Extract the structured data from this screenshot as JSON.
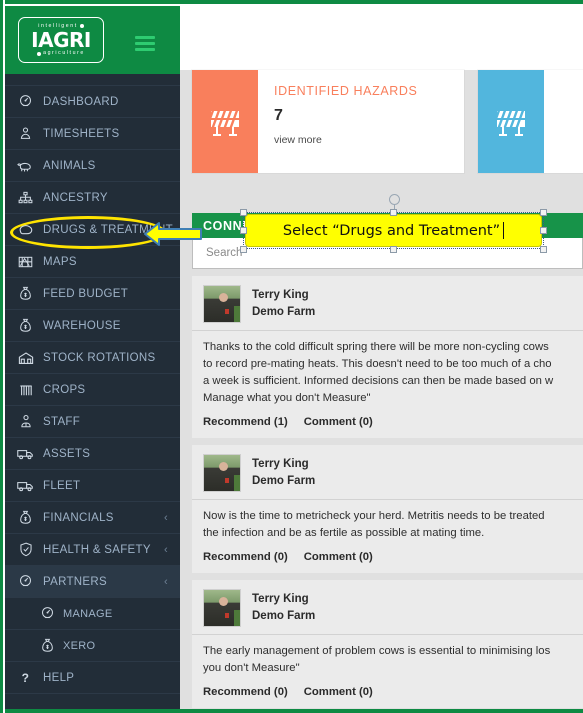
{
  "theme": {
    "brand_green": "#0e8a43",
    "sidebar_bg": "#222d38",
    "sidebar_text": "#9fb3c8",
    "connect_green": "#179349",
    "hazard_orange": "#f97f5c",
    "card2_blue": "#52b6dd",
    "highlight_yellow": "#ffe400",
    "callout_yellow": "#ffff00"
  },
  "sidebar": {
    "logo": {
      "top_text": "intelligent",
      "main_text": "IAGRI",
      "bottom_text": "agriculture"
    },
    "menu_icon": "hamburger-icon",
    "items": [
      {
        "label": "DASHBOARD",
        "icon": "gauge-icon",
        "chevron": "",
        "active": false,
        "sub": false
      },
      {
        "label": "TIMESHEETS",
        "icon": "person-clock-icon",
        "chevron": "",
        "active": false,
        "sub": false
      },
      {
        "label": "ANIMALS",
        "icon": "sheep-icon",
        "chevron": "",
        "active": false,
        "sub": false
      },
      {
        "label": "ANCESTRY",
        "icon": "hierarchy-icon",
        "chevron": "",
        "active": false,
        "sub": false
      },
      {
        "label": "DRUGS & TREATMENT",
        "icon": "pill-icon",
        "chevron": "",
        "active": false,
        "sub": false
      },
      {
        "label": "MAPS",
        "icon": "map-icon",
        "chevron": "",
        "active": false,
        "sub": false
      },
      {
        "label": "FEED BUDGET",
        "icon": "money-bag-icon",
        "chevron": "",
        "active": false,
        "sub": false
      },
      {
        "label": "WAREHOUSE",
        "icon": "money-bag-icon",
        "chevron": "",
        "active": false,
        "sub": false
      },
      {
        "label": "STOCK ROTATIONS",
        "icon": "barn-icon",
        "chevron": "",
        "active": false,
        "sub": false
      },
      {
        "label": "CROPS",
        "icon": "crops-icon",
        "chevron": "",
        "active": false,
        "sub": false
      },
      {
        "label": "STAFF",
        "icon": "person-tie-icon",
        "chevron": "",
        "active": false,
        "sub": false
      },
      {
        "label": "ASSETS",
        "icon": "truck-icon",
        "chevron": "",
        "active": false,
        "sub": false
      },
      {
        "label": "FLEET",
        "icon": "truck-icon",
        "chevron": "",
        "active": false,
        "sub": false
      },
      {
        "label": "FINANCIALS",
        "icon": "money-bag-icon",
        "chevron": "‹",
        "active": false,
        "sub": false
      },
      {
        "label": "HEALTH & SAFETY",
        "icon": "shield-check-icon",
        "chevron": "‹",
        "active": false,
        "sub": false
      },
      {
        "label": "PARTNERS",
        "icon": "gauge-icon",
        "chevron": "‹",
        "active": true,
        "sub": false
      },
      {
        "label": "MANAGE",
        "icon": "gauge-icon",
        "chevron": "",
        "active": false,
        "sub": true
      },
      {
        "label": "XERO",
        "icon": "money-bag-icon",
        "chevron": "",
        "active": false,
        "sub": true
      },
      {
        "label": "HELP",
        "icon": "question-icon",
        "chevron": "",
        "active": false,
        "sub": false
      }
    ]
  },
  "cards": [
    {
      "title": "IDENTIFIED HAZARDS",
      "value": "7",
      "more_label": "view more",
      "icon": "hazard-barrier-icon",
      "accent": "#f97f5c"
    },
    {
      "title": "",
      "value": "",
      "more_label": "",
      "icon": "hazard-barrier-icon",
      "accent": "#52b6dd"
    }
  ],
  "connect": {
    "header": "CONNECT",
    "search_placeholder": "Search",
    "search_value": ""
  },
  "feed": {
    "posts": [
      {
        "author": "Terry King",
        "farm": "Demo Farm",
        "body": "Thanks to the cold difficult spring there will be more non-cycling cows\nto record pre-mating heats. This doesn't need to be too much of a cho\na week is sufficient. Informed decisions can then be made based on w\nManage what you don't Measure\"",
        "recommend_label": "Recommend (1)",
        "comment_label": "Comment (0)"
      },
      {
        "author": "Terry King",
        "farm": "Demo Farm",
        "body": "Now is the time to metricheck your herd. Metritis needs to be treated\nthe infection and be as fertile as possible at mating time.",
        "recommend_label": "Recommend (0)",
        "comment_label": "Comment (0)"
      },
      {
        "author": "Terry King",
        "farm": "Demo Farm",
        "body": "The early management of problem cows is essential to minimising los\nyou don't Measure\"",
        "recommend_label": "Recommend (0)",
        "comment_label": "Comment (0)"
      }
    ]
  },
  "annotation": {
    "callout_text": "Select “Drugs and Treatment”",
    "arrow_direction": "left",
    "highlight_target": "DRUGS & TREATMENT"
  }
}
